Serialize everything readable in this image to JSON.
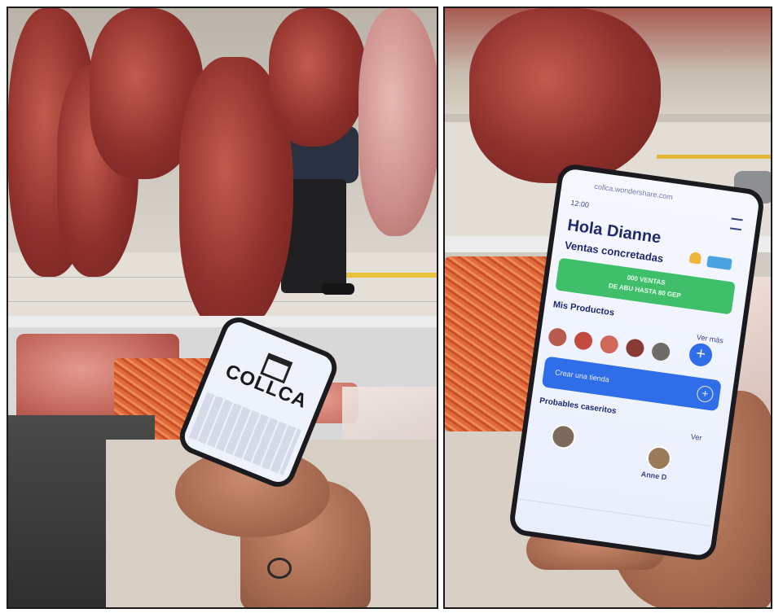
{
  "left_photo": {
    "phone_app": {
      "logo_text": "COLLCA"
    }
  },
  "right_photo": {
    "phone_app": {
      "status_time": "12:00",
      "url": "collca.wondershare.com",
      "greeting": "Hola Dianne",
      "sales_heading": "Ventas concretadas",
      "sales_banner_line1": "000 VENTAS",
      "sales_banner_line2": "DE ABU HASTA 80 GEP",
      "products_heading": "Mis Productos",
      "products_link": "Ver más",
      "add_button_label": "Crear una tienda",
      "customers_heading": "Probables caseritos",
      "customers_link": "Ver",
      "customer_name": "Anne D"
    }
  },
  "colors": {
    "app_primary": "#2f6ee8",
    "sales_banner": "#3fbf6a",
    "meat": "#8e2f2a",
    "mince": "#e06a3b"
  }
}
